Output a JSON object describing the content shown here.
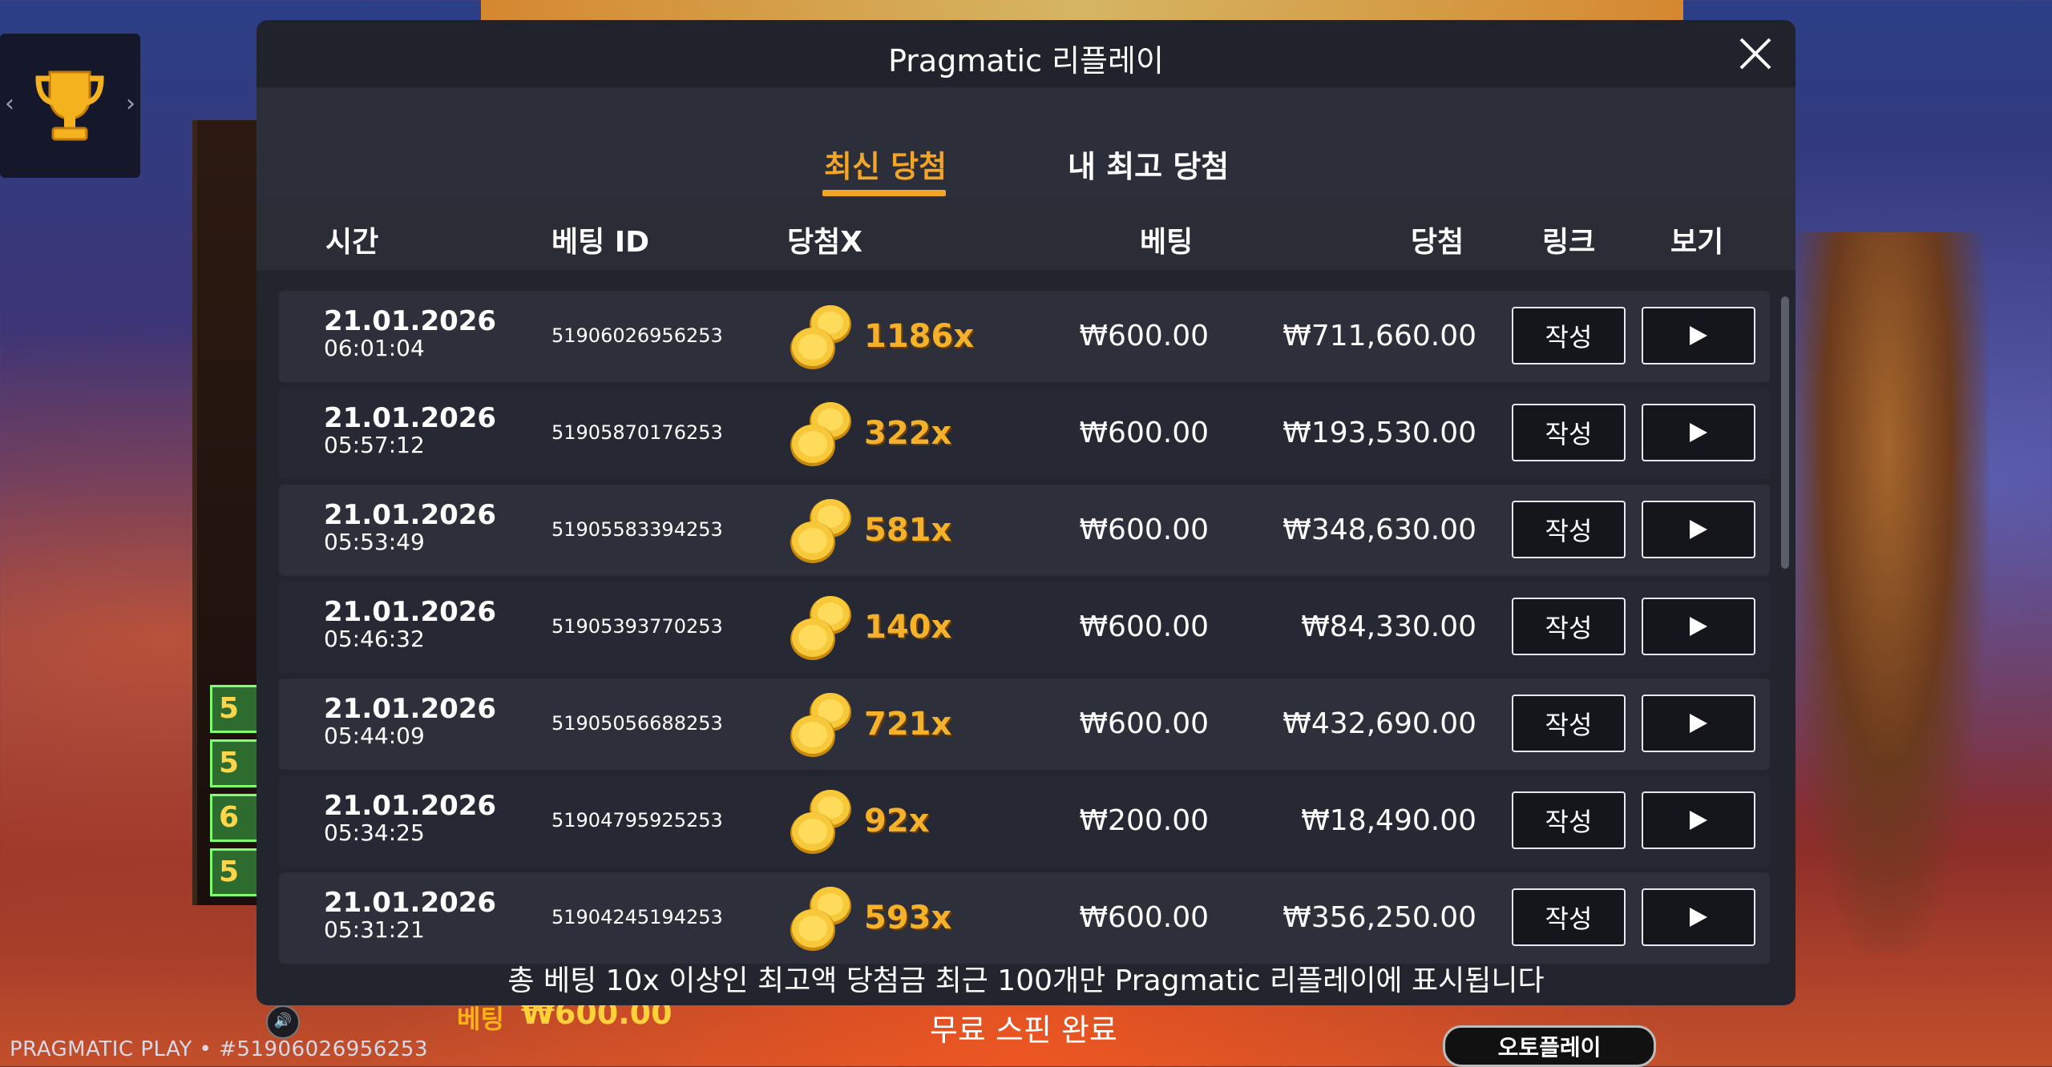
{
  "modal": {
    "title": "Pragmatic 리플레이",
    "tabs": [
      {
        "label": "최신 당첨",
        "active": true
      },
      {
        "label": "내 최고 당첨",
        "active": false
      }
    ],
    "columns": [
      "시간",
      "베팅 ID",
      "당첨X",
      "베팅",
      "당첨",
      "링크",
      "보기"
    ],
    "rows": [
      {
        "date": "21.01.2026",
        "time": "06:01:04",
        "bet_id": "51906026956253",
        "multiplier": "1186x",
        "bet": "₩600.00",
        "win": "₩711,660.00",
        "link_label": "작성"
      },
      {
        "date": "21.01.2026",
        "time": "05:57:12",
        "bet_id": "51905870176253",
        "multiplier": "322x",
        "bet": "₩600.00",
        "win": "₩193,530.00",
        "link_label": "작성"
      },
      {
        "date": "21.01.2026",
        "time": "05:53:49",
        "bet_id": "51905583394253",
        "multiplier": "581x",
        "bet": "₩600.00",
        "win": "₩348,630.00",
        "link_label": "작성"
      },
      {
        "date": "21.01.2026",
        "time": "05:46:32",
        "bet_id": "51905393770253",
        "multiplier": "140x",
        "bet": "₩600.00",
        "win": "₩84,330.00",
        "link_label": "작성"
      },
      {
        "date": "21.01.2026",
        "time": "05:44:09",
        "bet_id": "51905056688253",
        "multiplier": "721x",
        "bet": "₩600.00",
        "win": "₩432,690.00",
        "link_label": "작성"
      },
      {
        "date": "21.01.2026",
        "time": "05:34:25",
        "bet_id": "51904795925253",
        "multiplier": "92x",
        "bet": "₩200.00",
        "win": "₩18,490.00",
        "link_label": "작성"
      },
      {
        "date": "21.01.2026",
        "time": "05:31:21",
        "bet_id": "51904245194253",
        "multiplier": "593x",
        "bet": "₩600.00",
        "win": "₩356,250.00",
        "link_label": "작성"
      }
    ],
    "footer_note": "총 베팅 10x 이상인 최고액 당첨금 최근 100개만 Pragmatic 리플레이에 표시됩니다"
  },
  "game": {
    "brand": "PRAGMATIC PLAY • #51906026956253",
    "bet_label": "베팅",
    "bet_value": "₩600.00",
    "status": "무료 스핀 완료",
    "autoplay_label": "오토플레이",
    "side_symbols": [
      "5",
      "5",
      "6",
      "5"
    ]
  },
  "colors": {
    "accent": "#f3a527",
    "modal_bg": "#22252e",
    "multiplier": "#f6b12a"
  },
  "icons": {
    "close": "close-icon",
    "trophy": "trophy-icon",
    "play": "play-icon",
    "coin": "coin-stack-icon"
  }
}
